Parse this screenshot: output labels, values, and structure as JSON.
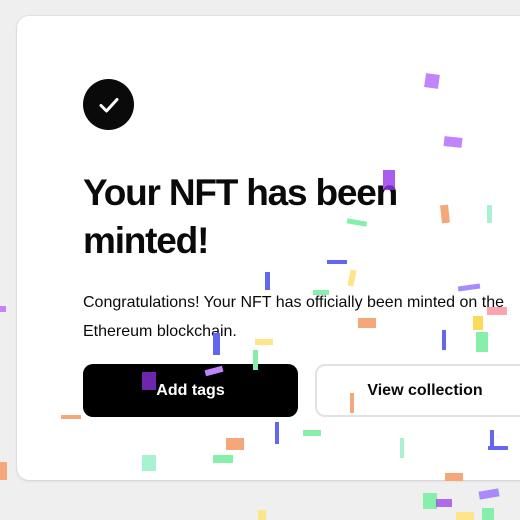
{
  "dialog": {
    "title": "Your NFT has been minted!",
    "message": "Congratulations! Your NFT has officially been minted on the Ethereum blockchain.",
    "primary_button": "Add tags",
    "secondary_button": "View collection",
    "icon": "checkmark-icon"
  },
  "colors": {
    "page_background": "#efefef",
    "card_background": "#ffffff",
    "primary_button": "#000000",
    "text": "#0a0a0a",
    "confetti": [
      "#c084fc",
      "#a78bfa",
      "#f6a77a",
      "#86efac",
      "#a7f3d0",
      "#6366f1",
      "#fde68a",
      "#9333ea",
      "#facc15",
      "#fda4af"
    ]
  }
}
